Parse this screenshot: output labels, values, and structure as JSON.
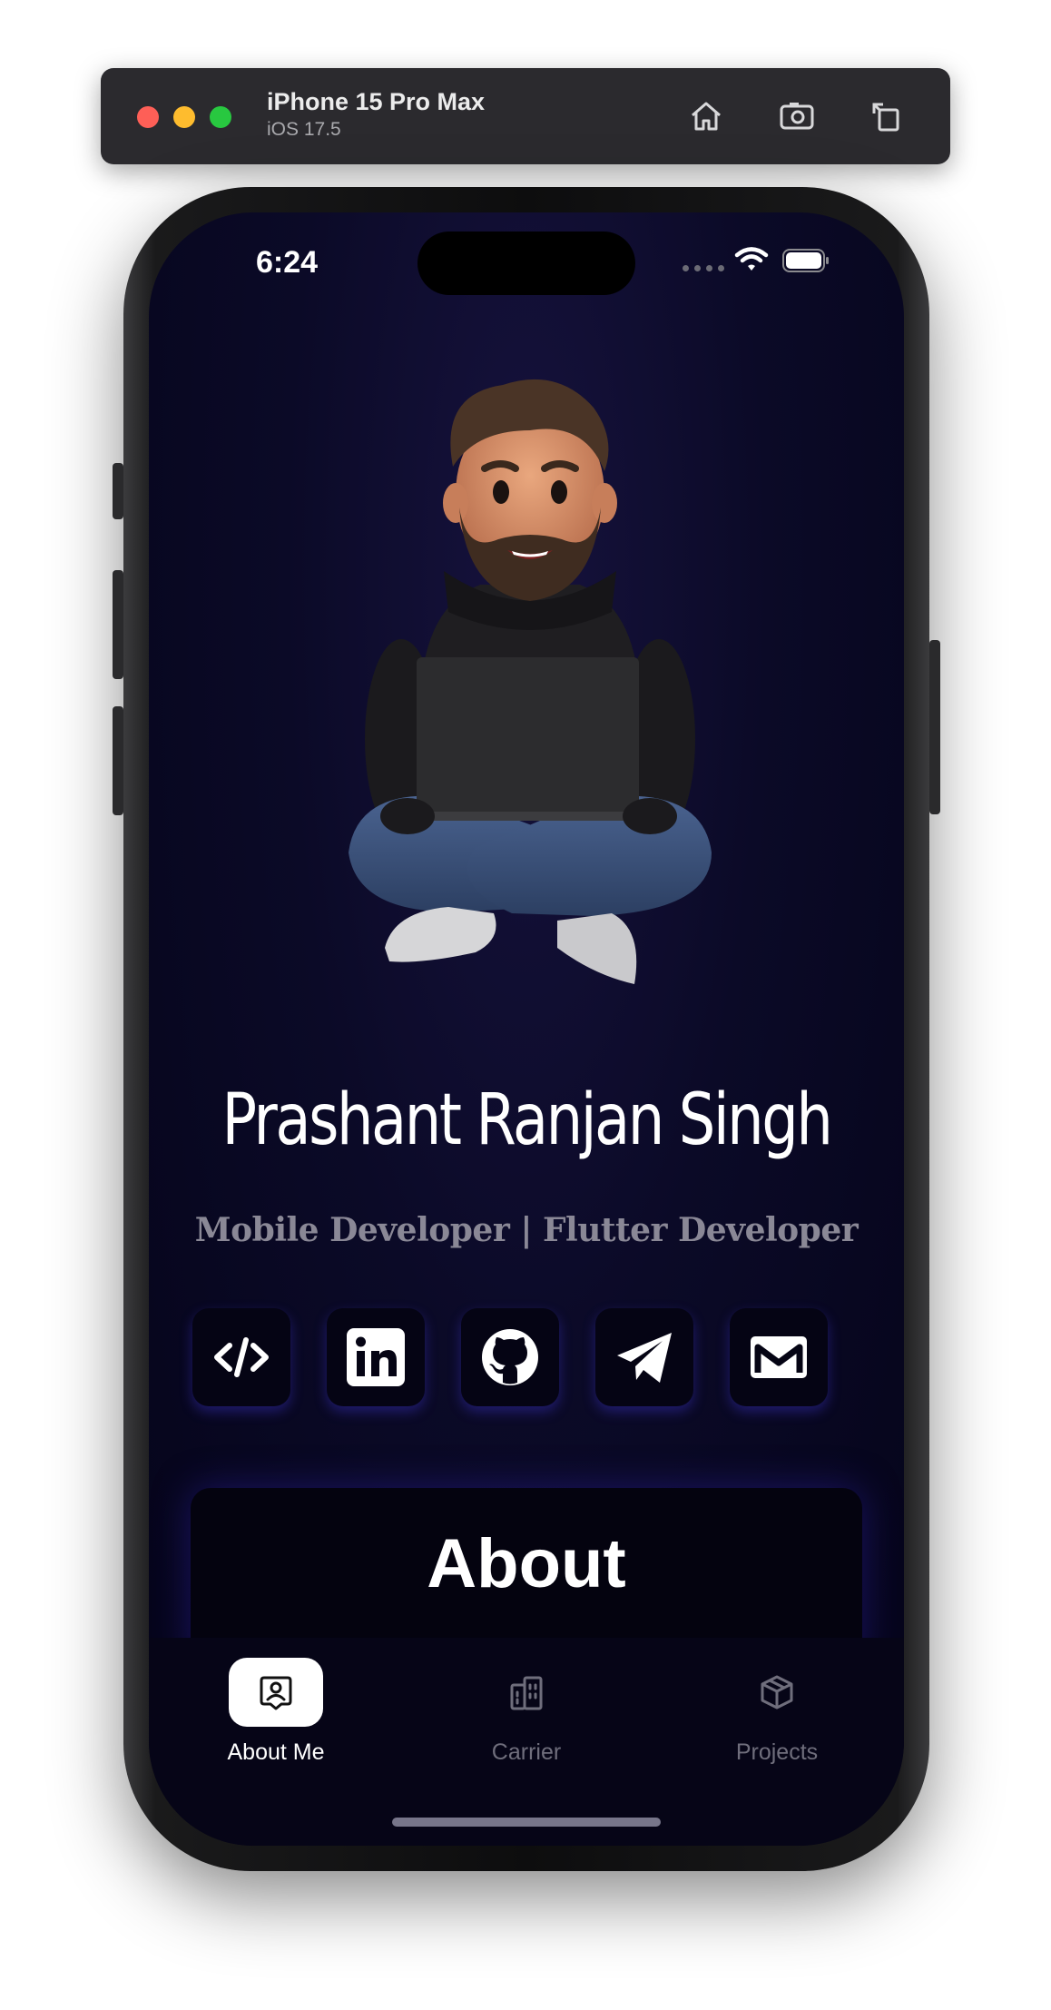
{
  "simulator": {
    "device_name": "iPhone 15 Pro Max",
    "os_version": "iOS 17.5",
    "buttons": [
      "home-icon",
      "screenshot-icon",
      "rotate-icon"
    ]
  },
  "status_bar": {
    "time": "6:24"
  },
  "profile": {
    "name": "Prashant Ranjan Singh",
    "role": "Mobile Developer | Flutter Developer"
  },
  "socials": [
    {
      "icon": "code-icon"
    },
    {
      "icon": "linkedin-icon"
    },
    {
      "icon": "github-icon"
    },
    {
      "icon": "telegram-icon"
    },
    {
      "icon": "gmail-icon"
    }
  ],
  "about": {
    "title": "About"
  },
  "bottom_nav": {
    "items": [
      {
        "label": "About Me",
        "icon": "profile-badge-icon",
        "active": true
      },
      {
        "label": "Carrier",
        "icon": "building-icon",
        "active": false
      },
      {
        "label": "Projects",
        "icon": "box-icon",
        "active": false
      }
    ]
  },
  "colors": {
    "background": "#0b0a27",
    "accent_glow": "#3c32c8",
    "inactive_text": "#6f6e7c"
  }
}
